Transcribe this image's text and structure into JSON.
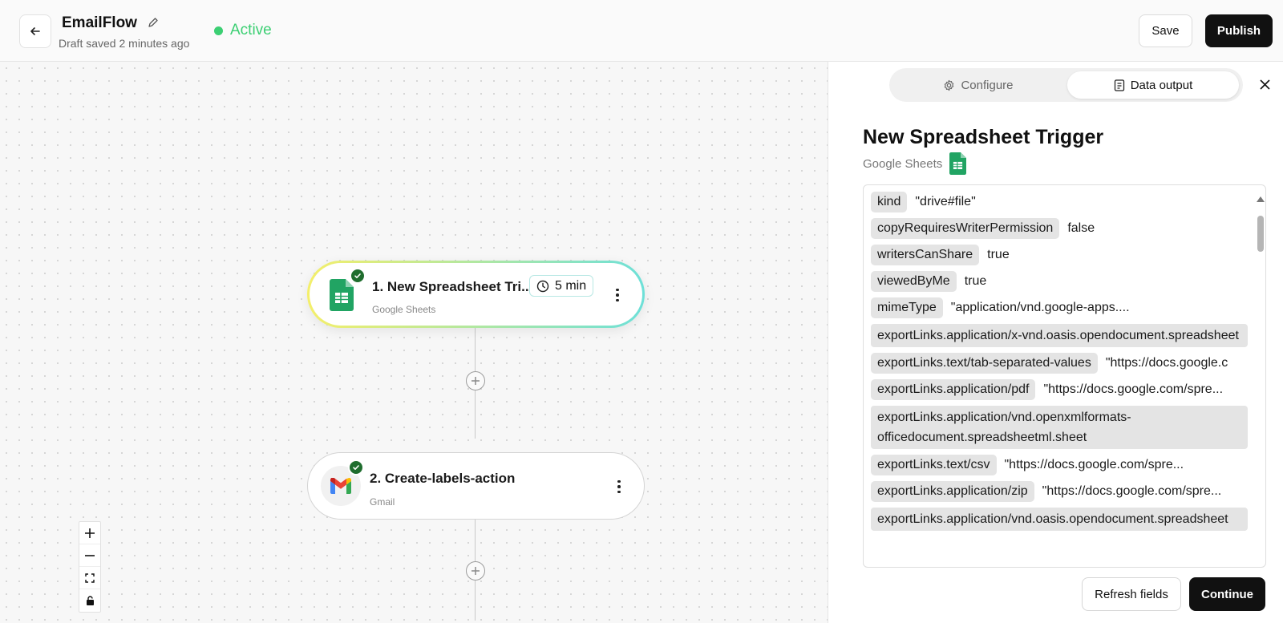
{
  "header": {
    "title": "EmailFlow",
    "draft_status": "Draft saved 2 minutes ago",
    "status_label": "Active",
    "save_label": "Save",
    "publish_label": "Publish"
  },
  "canvas": {
    "nodes": [
      {
        "title": "1. New Spreadsheet Tri...",
        "subtitle": "Google Sheets",
        "timer": "5 min"
      },
      {
        "title": "2. Create-labels-action",
        "subtitle": "Gmail"
      }
    ]
  },
  "panel": {
    "tabs": [
      {
        "label": "Configure"
      },
      {
        "label": "Data output"
      }
    ],
    "title": "New Spreadsheet Trigger",
    "source": "Google Sheets",
    "rows": [
      {
        "key": "kind",
        "value": "\"drive#file\""
      },
      {
        "key": "copyRequiresWriterPermission",
        "value": "false"
      },
      {
        "key": "writersCanShare",
        "value": "true"
      },
      {
        "key": "viewedByMe",
        "value": "true"
      },
      {
        "key": "mimeType",
        "value": "\"application/vnd.google-apps...."
      },
      {
        "key": "exportLinks.application/x-vnd.oasis.opendocument.spreadsheet",
        "value": ""
      },
      {
        "key": "exportLinks.text/tab-separated-values",
        "value": "\"https://docs.google.c"
      },
      {
        "key": "exportLinks.application/pdf",
        "value": "\"https://docs.google.com/spre..."
      },
      {
        "key": "exportLinks.application/vnd.openxmlformats-officedocument.spreadsheetml.sheet",
        "value": ""
      },
      {
        "key": "exportLinks.text/csv",
        "value": "\"https://docs.google.com/spre..."
      },
      {
        "key": "exportLinks.application/zip",
        "value": "\"https://docs.google.com/spre..."
      },
      {
        "key": "exportLinks.application/vnd.oasis.opendocument.spreadsheet",
        "value": ""
      }
    ],
    "refresh_label": "Refresh fields",
    "continue_label": "Continue"
  },
  "colors": {
    "active": "#3ccf73",
    "primary_button": "#111111",
    "node_gradient_start": "#f4ef6a",
    "node_gradient_end": "#6de0d8",
    "check_badge": "#1f6d2e",
    "sheets_green": "#21a463"
  },
  "icons": [
    "back-arrow-icon",
    "pencil-icon",
    "google-sheets-icon",
    "check-icon",
    "clock-icon",
    "more-vertical-icon",
    "plus-circle-icon",
    "gmail-icon",
    "zoom-in-icon",
    "zoom-out-icon",
    "fit-view-icon",
    "lock-icon",
    "gear-icon",
    "document-icon",
    "close-icon"
  ]
}
